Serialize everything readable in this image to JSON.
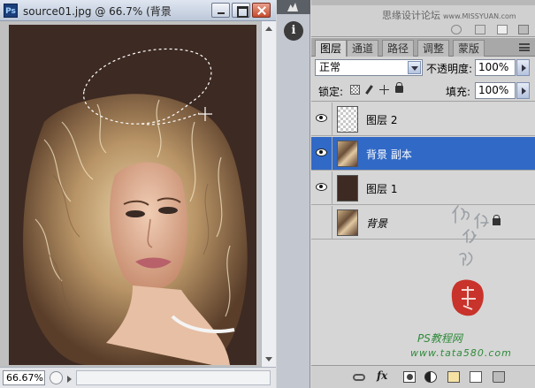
{
  "document": {
    "app_icon_label": "Ps",
    "title": "source01.jpg @ 66.7% (背景"
  },
  "status": {
    "zoom": "66.67%"
  },
  "top_panel": {
    "watermark": "思缘设计论坛",
    "watermark_url": "www.MISSYUAN.com"
  },
  "middle_strip": {
    "info_label": "i"
  },
  "layers_panel": {
    "tabs": [
      {
        "label": "图层",
        "active": true
      },
      {
        "label": "通道",
        "active": false
      },
      {
        "label": "路径",
        "active": false
      },
      {
        "label": "调整",
        "active": false
      },
      {
        "label": "蒙版",
        "active": false
      }
    ],
    "blend_mode": "正常",
    "opacity_label": "不透明度:",
    "opacity_value": "100%",
    "lock_label": "锁定:",
    "fill_label": "填充:",
    "fill_value": "100%",
    "layers": [
      {
        "name": "图层 2",
        "visible": true,
        "selected": false,
        "thumb": "transparent",
        "locked": false
      },
      {
        "name": "背景 副本",
        "visible": true,
        "selected": true,
        "thumb": "photo",
        "locked": false
      },
      {
        "name": "图层 1",
        "visible": true,
        "selected": false,
        "thumb": "dark",
        "locked": false
      },
      {
        "name": "背景",
        "visible": false,
        "selected": false,
        "thumb": "photo",
        "locked": true
      }
    ]
  },
  "watermark_bottom": {
    "brand": "PS教程网",
    "url": "www.tata580.com"
  },
  "colors": {
    "selection_blue": "#3169c6",
    "canvas_background": "#3d2a22",
    "brand_green": "#2f8a3a",
    "seal_red": "#c8332b"
  }
}
